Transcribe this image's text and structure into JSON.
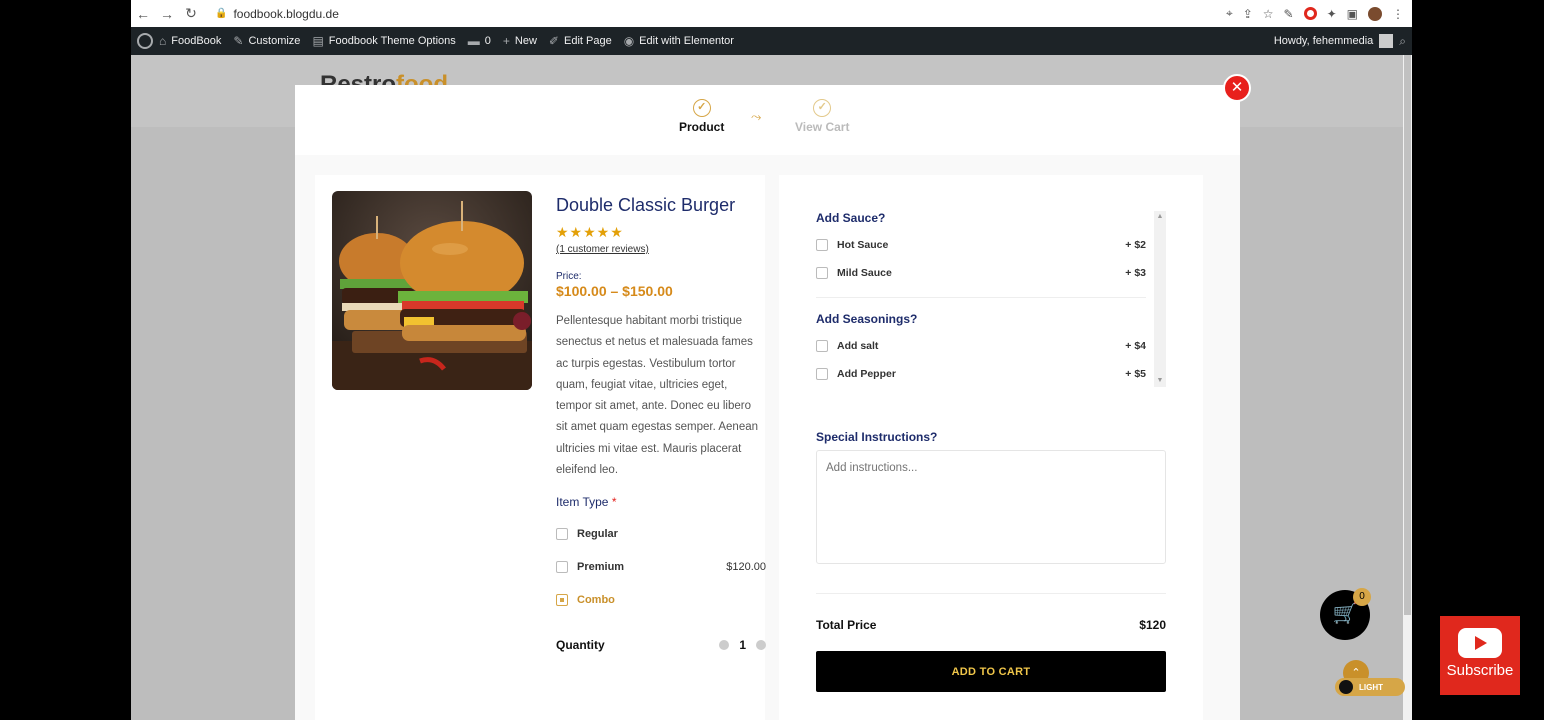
{
  "browser": {
    "url": "foodbook.blogdu.de"
  },
  "adminbar": {
    "site": "FoodBook",
    "customize": "Customize",
    "theme_options": "Foodbook Theme Options",
    "comments_count": "0",
    "new": "New",
    "edit_page": "Edit Page",
    "edit_elementor": "Edit with Elementor",
    "howdy": "Howdy, fehemmedia"
  },
  "site": {
    "logo_main": "Restro",
    "logo_accent": "food"
  },
  "steps": {
    "product": "Product",
    "view_cart": "View Cart"
  },
  "product": {
    "title": "Double Classic Burger",
    "stars": "★★★★★",
    "reviews": "(1 customer reviews)",
    "price_label": "Price:",
    "price_range": "$100.00 – $150.00",
    "description": "Pellentesque habitant morbi tristique senectus et netus et malesuada fames ac turpis egestas. Vestibulum tortor quam, feugiat vitae, ultricies eget, tempor sit amet, ante. Donec eu libero sit amet quam egestas semper. Aenean ultricies mi vitae est. Mauris placerat eleifend leo.",
    "item_type_label": "Item Type",
    "required_mark": "*",
    "item_types": [
      {
        "label": "Regular",
        "price": ""
      },
      {
        "label": "Premium",
        "price": "$120.00"
      },
      {
        "label": "Combo",
        "price": ""
      }
    ],
    "quantity_label": "Quantity",
    "quantity": "1"
  },
  "addons": {
    "sauce_title": "Add Sauce?",
    "sauces": [
      {
        "label": "Hot Sauce",
        "price": "+ $2"
      },
      {
        "label": "Mild Sauce",
        "price": "+ $3"
      }
    ],
    "seasoning_title": "Add Seasonings?",
    "seasonings": [
      {
        "label": "Add salt",
        "price": "+ $4"
      },
      {
        "label": "Add Pepper",
        "price": "+ $5"
      }
    ]
  },
  "special": {
    "label": "Special Instructions?",
    "placeholder": "Add instructions..."
  },
  "total": {
    "label": "Total Price",
    "value": "$120"
  },
  "cart": {
    "add_button": "ADD TO CART",
    "count": "0"
  },
  "theme_toggle": "LIGHT",
  "youtube": {
    "label": "Subscribe"
  },
  "colors": {
    "accent": "#d6a647",
    "navy": "#1e2c6b",
    "close": "#e8201c"
  }
}
